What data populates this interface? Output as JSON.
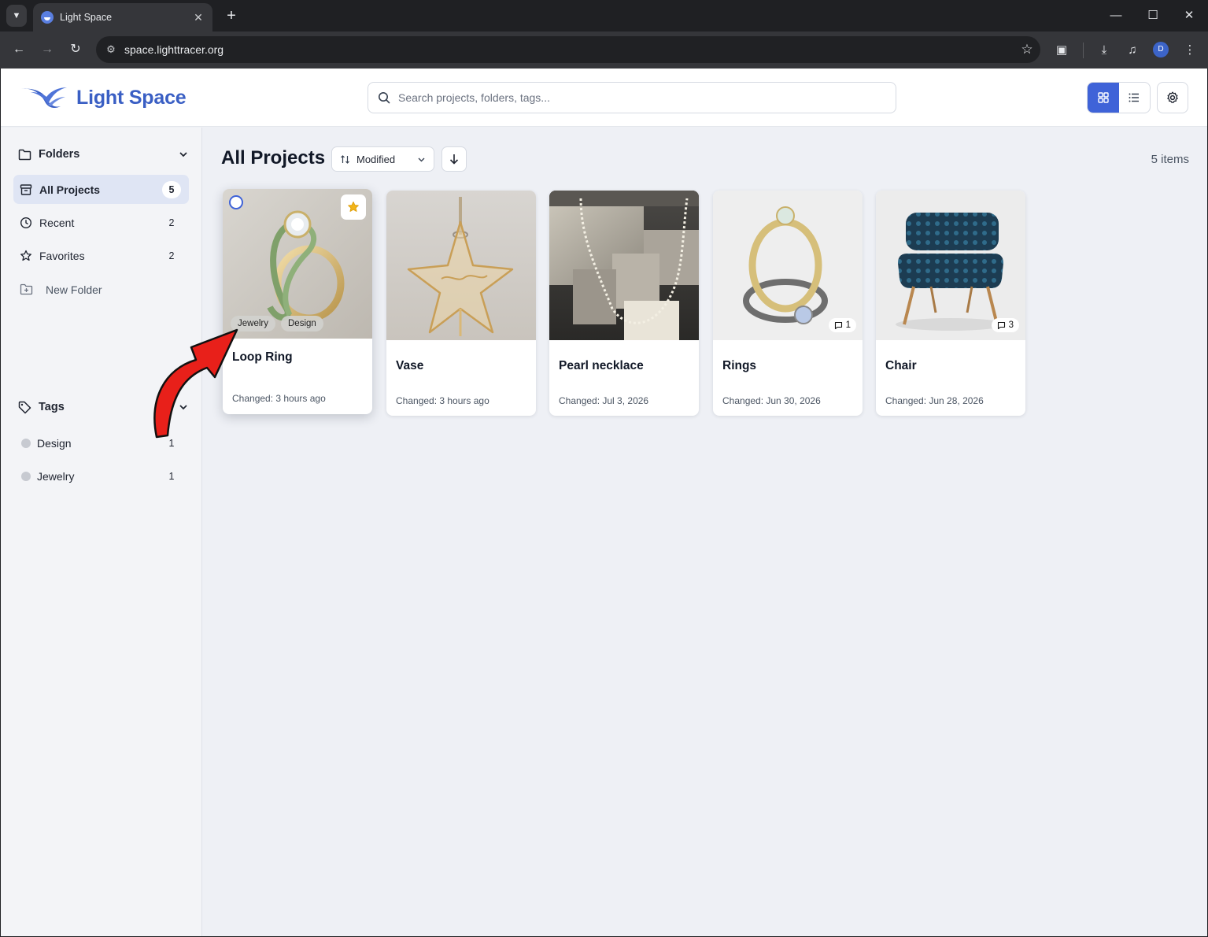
{
  "browser": {
    "tab_title": "Light Space",
    "url": "space.lighttracer.org",
    "profile_initial": "D"
  },
  "app": {
    "brand": "Light Space",
    "search_placeholder": "Search projects, folders, tags...",
    "view_mode": "grid",
    "accent_color": "#3f63d8"
  },
  "sidebar": {
    "folders_header": "Folders",
    "items": [
      {
        "label": "All Projects",
        "count": "5",
        "icon": "archive-icon",
        "active": true
      },
      {
        "label": "Recent",
        "count": "2",
        "icon": "clock-icon"
      },
      {
        "label": "Favorites",
        "count": "2",
        "icon": "star-outline-icon"
      }
    ],
    "new_folder": "New Folder",
    "tags_header": "Tags",
    "tags": [
      {
        "label": "Design",
        "count": "1"
      },
      {
        "label": "Jewelry",
        "count": "1"
      }
    ]
  },
  "main": {
    "title": "All Projects",
    "sort_by": "Modified",
    "sort_direction": "descending",
    "item_count": "5 items",
    "projects": [
      {
        "title": "Loop Ring",
        "changed": "Changed: 3 hours ago",
        "favorite": true,
        "tags": [
          "Jewelry",
          "Design"
        ],
        "comments": null
      },
      {
        "title": "Vase",
        "changed": "Changed: 3 hours ago",
        "favorite": false,
        "tags": [],
        "comments": null
      },
      {
        "title": "Pearl necklace",
        "changed": "Changed: Jul 3, 2026",
        "favorite": false,
        "tags": [],
        "comments": null
      },
      {
        "title": "Rings",
        "changed": "Changed: Jun 30, 2026",
        "favorite": false,
        "tags": [],
        "comments": "1"
      },
      {
        "title": "Chair",
        "changed": "Changed: Jun 28, 2026",
        "favorite": false,
        "tags": [],
        "comments": "3"
      }
    ]
  }
}
